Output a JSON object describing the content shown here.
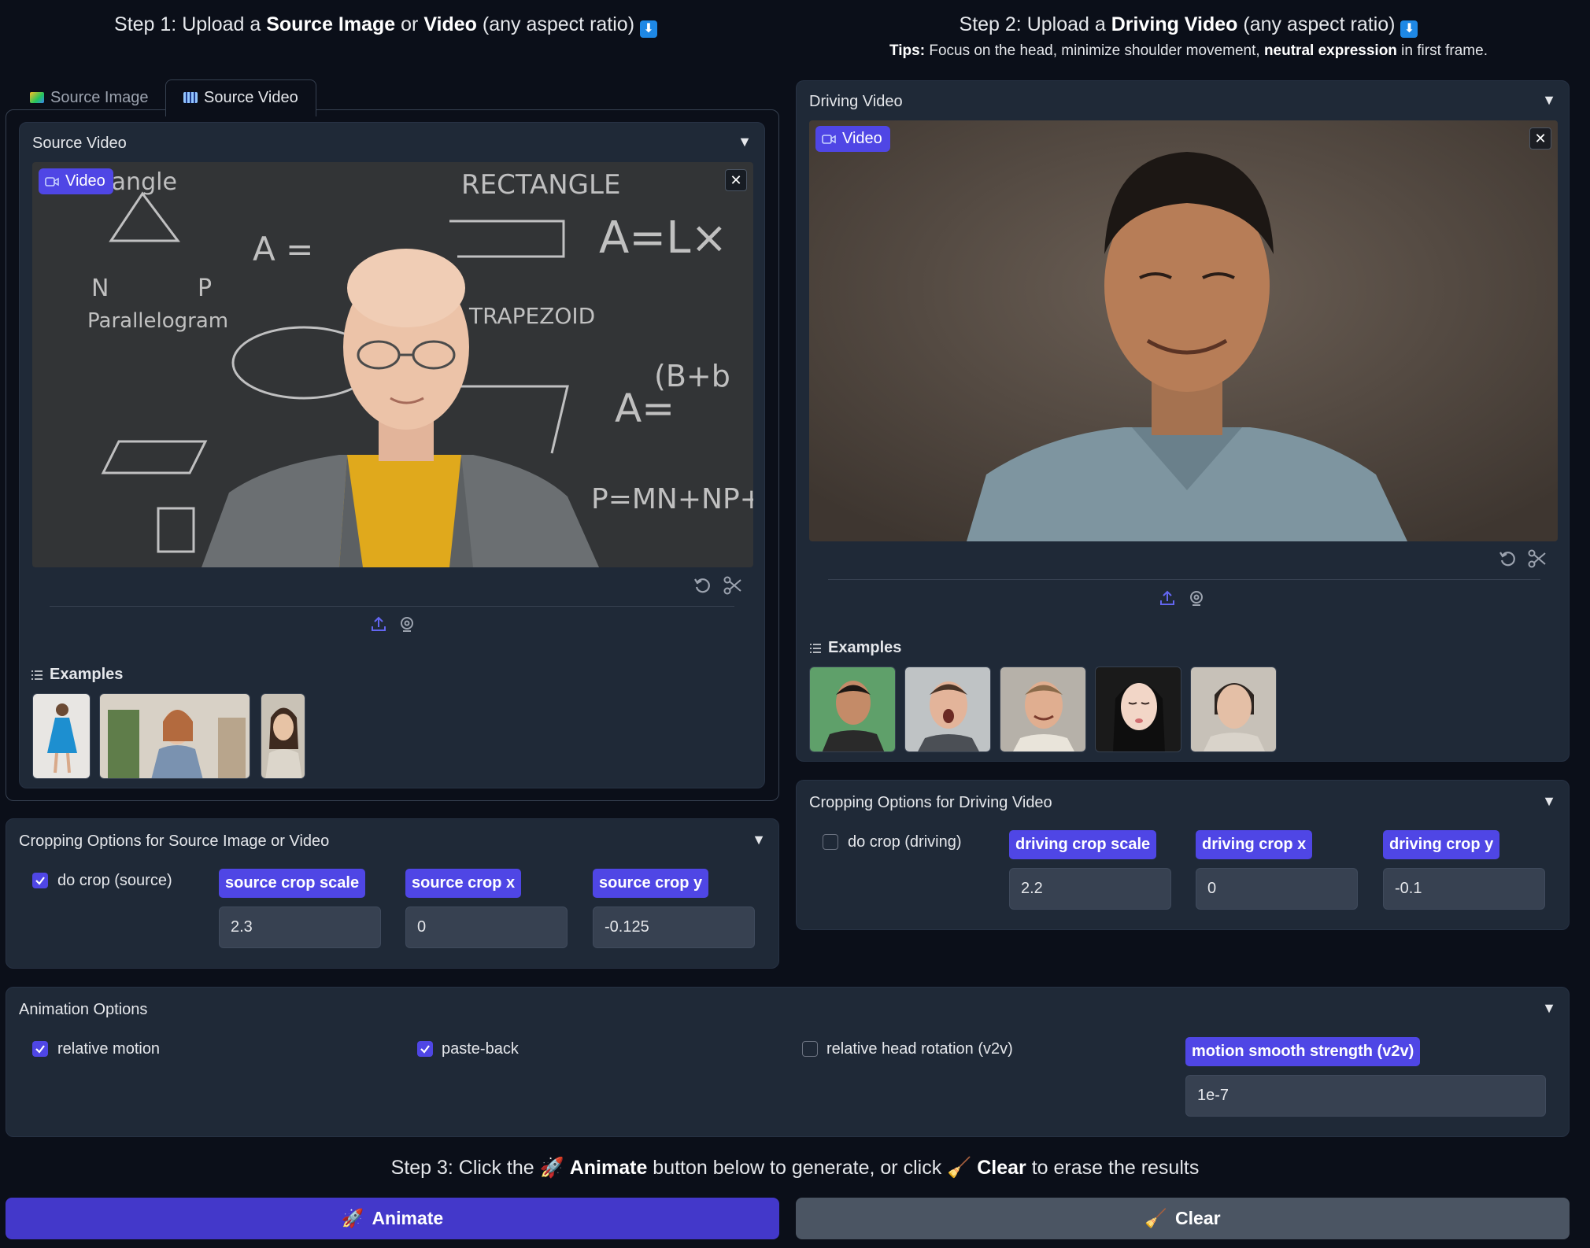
{
  "step1": {
    "prefix": "Step 1: Upload a ",
    "source_image": "Source Image",
    "or": " or ",
    "video": "Video",
    "suffix": " (any aspect ratio) ",
    "arrow": "⬇"
  },
  "step2": {
    "prefix": "Step 2: Upload a ",
    "driving_video": "Driving Video",
    "suffix": " (any aspect ratio) ",
    "arrow": "⬇",
    "tips_label": "Tips:",
    "tips_text1": " Focus on the head, minimize shoulder movement, ",
    "tips_bold": "neutral expression",
    "tips_text2": " in first frame."
  },
  "tabs": [
    {
      "label": "Source Image",
      "icon": "picture-icon",
      "selected": false
    },
    {
      "label": "Source Video",
      "icon": "film-icon",
      "selected": true
    }
  ],
  "source_video": {
    "label": "Source Video",
    "badge": "Video",
    "examples_label": "Examples",
    "examples": [
      "example-dancer",
      "example-woman-room",
      "example-woman-portrait"
    ]
  },
  "driving_video": {
    "label": "Driving Video",
    "badge": "Video",
    "examples_label": "Examples",
    "examples": [
      "example-man-green",
      "example-man-open-mouth",
      "example-man-smile",
      "example-woman-closed-eyes",
      "example-woman-neutral"
    ]
  },
  "crop_source": {
    "label": "Cropping Options for Source Image or Video",
    "do_crop_label": "do crop (source)",
    "do_crop_checked": true,
    "scale_label": "source crop scale",
    "scale_value": "2.3",
    "x_label": "source crop x",
    "x_value": "0",
    "y_label": "source crop y",
    "y_value": "-0.125"
  },
  "crop_driving": {
    "label": "Cropping Options for Driving Video",
    "do_crop_label": "do crop (driving)",
    "do_crop_checked": false,
    "scale_label": "driving crop scale",
    "scale_value": "2.2",
    "x_label": "driving crop x",
    "x_value": "0",
    "y_label": "driving crop y",
    "y_value": "-0.1"
  },
  "animation": {
    "label": "Animation Options",
    "relative_motion": "relative motion",
    "relative_motion_checked": true,
    "paste_back": "paste-back",
    "paste_back_checked": true,
    "relative_head_rotation": "relative head rotation (v2v)",
    "relative_head_rotation_checked": false,
    "smooth_label": "motion smooth strength (v2v)",
    "smooth_value": "1e-7"
  },
  "step3": {
    "prefix": "Step 3: Click the ",
    "animate": "Animate",
    "middle": " button below to generate, or click ",
    "clear": "Clear",
    "suffix": " to erase the results"
  },
  "buttons": {
    "animate": "Animate",
    "clear": "Clear"
  },
  "colors": {
    "background": "#0b0f19",
    "panel": "#1f2937",
    "accent": "#4f46e5",
    "animate_button": "#4338ca",
    "clear_button": "#4b5563"
  }
}
